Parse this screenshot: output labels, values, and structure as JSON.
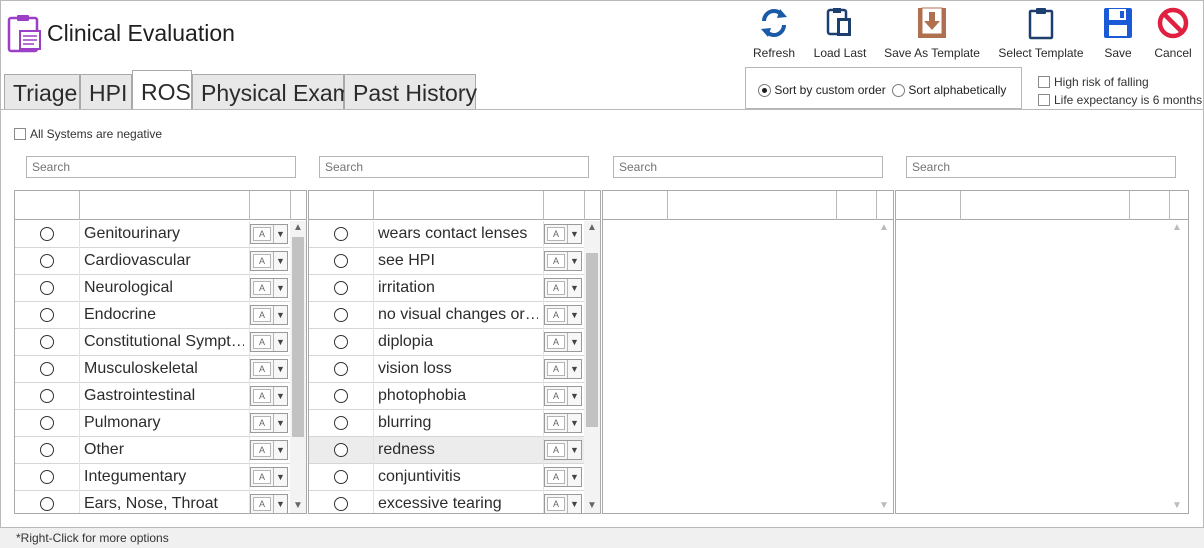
{
  "app": {
    "title": "Clinical Evaluation"
  },
  "toolbar": {
    "refresh": "Refresh",
    "load_last": "Load Last",
    "save_as_template": "Save As Template",
    "select_template": "Select Template",
    "save": "Save",
    "cancel": "Cancel"
  },
  "tabs": [
    "Triage",
    "HPI",
    "ROS",
    "Physical Exam",
    "Past History"
  ],
  "active_tab": "ROS",
  "sort": {
    "custom": "Sort by custom order",
    "alpha": "Sort alphabetically",
    "selected": "custom"
  },
  "flags": {
    "high_risk": "High risk of falling",
    "life_expectancy": "Life expectancy is 6 months"
  },
  "all_negative": "All Systems are negative",
  "search": {
    "placeholder1": "Search",
    "placeholder2": "Search",
    "placeholder3": "Search",
    "placeholder4": "Search"
  },
  "systems": [
    "Genitourinary",
    "Cardiovascular",
    "Neurological",
    "Endocrine",
    "Constitutional Sympt…",
    "Musculoskeletal",
    "Gastrointestinal",
    "Pulmonary",
    "Other",
    "Integumentary",
    "Ears, Nose, Throat"
  ],
  "symptoms": [
    "wears contact lenses",
    "see HPI",
    "irritation",
    "no visual changes or…",
    "diplopia",
    "vision loss",
    "photophobia",
    "blurring",
    "redness",
    "conjuntivitis",
    "excessive tearing"
  ],
  "highlighted_symptom_index": 8,
  "combo_icon": "text-format-icon",
  "footer": "*Right-Click for more options",
  "colors": {
    "refresh": "#1a5aa6",
    "save": "#1a5ad6",
    "cancel": "#e02040",
    "template": "#b07050",
    "app_icon": "#9b3fc7"
  }
}
